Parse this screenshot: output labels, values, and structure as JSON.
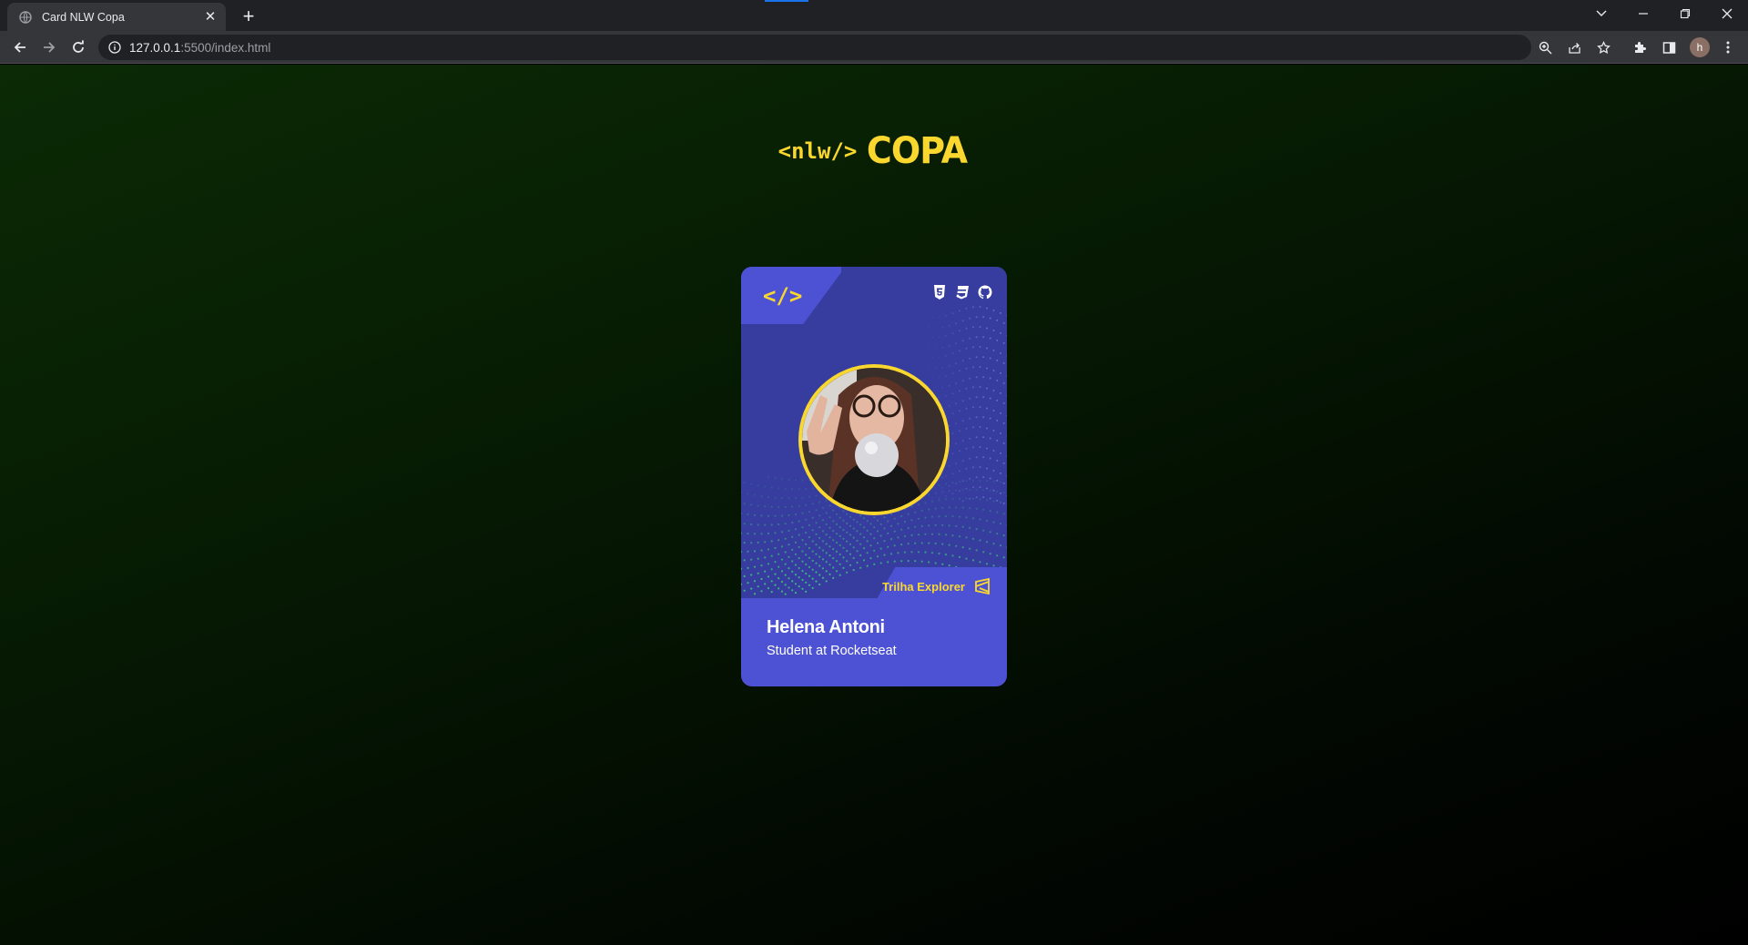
{
  "browser": {
    "tab_title": "Card NLW Copa",
    "url_host": "127.0.0.1",
    "url_rest": ":5500/index.html",
    "profile_initial": "h"
  },
  "page": {
    "logo_tag": "<nlw/>",
    "logo_word": "COPA"
  },
  "card": {
    "code_icon": "</>",
    "tech_icons": [
      "html5-icon",
      "css3-icon",
      "github-icon"
    ],
    "name": "Helena Antoni",
    "role": "Student at Rocketseat",
    "trilha_label": "Trilha Explorer",
    "trilha_icon": "explorer-icon"
  },
  "colors": {
    "accent_yellow": "#f9d72f",
    "card_blue": "#4c52d3",
    "card_dark": "#363d9f",
    "dots_green": "#3fd17a"
  }
}
